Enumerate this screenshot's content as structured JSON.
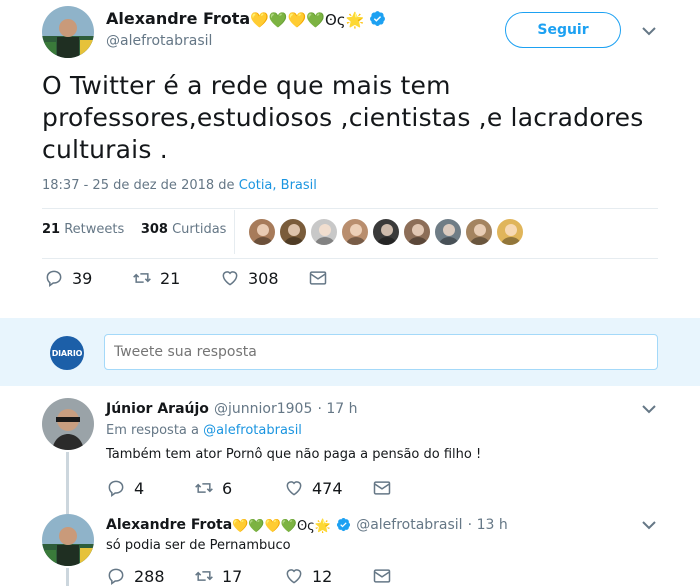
{
  "tweet": {
    "author_name": "Alexandre Frota",
    "author_emoji": "💛💚💛💚ʘς🌟",
    "author_handle": "@alefrotabrasil",
    "follow_label": "Seguir",
    "text": "O Twitter é a rede que mais tem professores,estudiosos ,cientistas ,e lacradores culturais .",
    "timestamp": "18:37 - 25 de dez de 2018",
    "location_prefix": "de",
    "location": "Cotia, Brasil",
    "retweets_count": "21",
    "retweets_label": "Retweets",
    "likes_count": "308",
    "likes_label": "Curtidas",
    "actions": {
      "replies": "39",
      "retweets": "21",
      "likes": "308"
    }
  },
  "reply_box": {
    "avatar_text": "DIARIO",
    "placeholder": "Tweete sua resposta"
  },
  "replies": [
    {
      "name": "Júnior Araújo",
      "handle": "@junnior1905",
      "time": "· 17 h",
      "in_reply_prefix": "Em resposta a",
      "in_reply_handle": "@alefrotabrasil",
      "text": "Também tem ator Pornô que não paga a pensão do filho !",
      "actions": {
        "replies": "4",
        "retweets": "6",
        "likes": "474"
      }
    },
    {
      "name": "Alexandre Frota",
      "emoji": "💛💚💛💚ʘς🌟",
      "handle": "@alefrotabrasil",
      "time": "· 13 h",
      "text": "só podia ser de Pernambuco",
      "actions": {
        "replies": "288",
        "retweets": "17",
        "likes": "12"
      }
    }
  ],
  "colors": {
    "accent": "#1da1f2",
    "link": "#1b95e0",
    "muted": "#657786",
    "reply_bar": "#e8f5fd"
  }
}
